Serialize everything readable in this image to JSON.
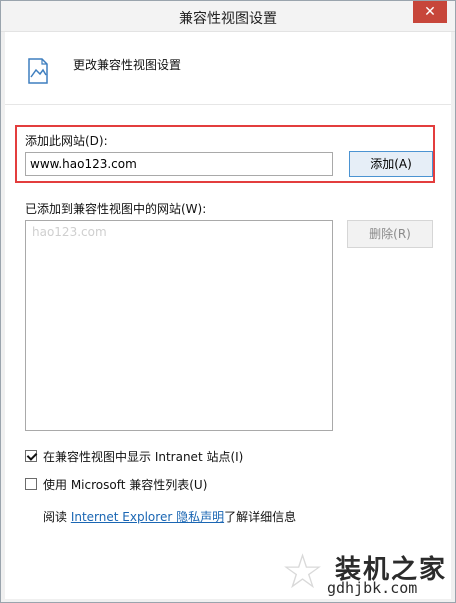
{
  "window": {
    "title": "兼容性视图设置",
    "close_glyph": "✕"
  },
  "header": {
    "icon": "page-icon",
    "text": "更改兼容性视图设置"
  },
  "add_site": {
    "label": "添加此网站(D):",
    "value": "www.hao123.com",
    "add_button": "添加(A)",
    "highlight_color": "#e33d3d"
  },
  "added_sites": {
    "label": "已添加到兼容性视图中的网站(W):",
    "items": [
      "hao123.com"
    ],
    "remove_button": "删除(R)"
  },
  "options": {
    "show_intranet": {
      "label": "在兼容性视图中显示 Intranet 站点(I)",
      "checked": true
    },
    "use_ms_list": {
      "label": "使用 Microsoft 兼容性列表(U)",
      "checked": false
    }
  },
  "privacy": {
    "prefix": "阅读 ",
    "link": "Internet Explorer 隐私声明",
    "suffix": "了解详细信息"
  },
  "watermark": {
    "star_glyph": "☆",
    "chinese": "装机之家",
    "english": "gdhjbk.com"
  }
}
